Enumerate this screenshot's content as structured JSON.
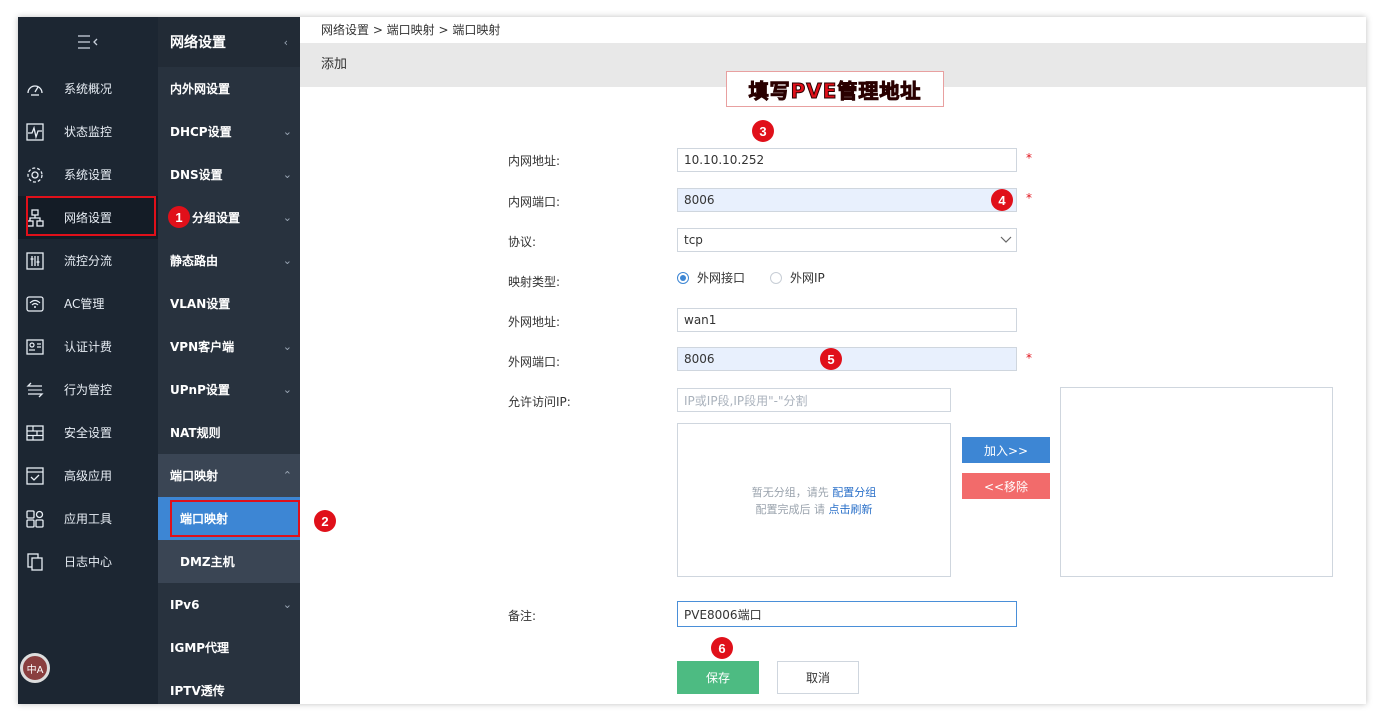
{
  "sidebar": {
    "items": [
      {
        "label": "系统概况",
        "icon": "dashboard-icon"
      },
      {
        "label": "状态监控",
        "icon": "monitor-icon"
      },
      {
        "label": "系统设置",
        "icon": "gear-icon"
      },
      {
        "label": "网络设置",
        "icon": "network-icon"
      },
      {
        "label": "流控分流",
        "icon": "sliders-icon"
      },
      {
        "label": "AC管理",
        "icon": "wifi-icon"
      },
      {
        "label": "认证计费",
        "icon": "id-card-icon"
      },
      {
        "label": "行为管控",
        "icon": "transfer-icon"
      },
      {
        "label": "安全设置",
        "icon": "firewall-icon"
      },
      {
        "label": "高级应用",
        "icon": "inbox-check-icon"
      },
      {
        "label": "应用工具",
        "icon": "apps-icon"
      },
      {
        "label": "日志中心",
        "icon": "log-icon"
      }
    ],
    "lang_badge": "中A"
  },
  "submenu": {
    "title": "网络设置",
    "items": [
      {
        "label": "内外网设置",
        "chevron": false
      },
      {
        "label": "DHCP设置",
        "chevron": true
      },
      {
        "label": "DNS设置",
        "chevron": true
      },
      {
        "label": "分组设置",
        "chevron": true
      },
      {
        "label": "静态路由",
        "chevron": true
      },
      {
        "label": "VLAN设置",
        "chevron": false
      },
      {
        "label": "VPN客户端",
        "chevron": true
      },
      {
        "label": "UPnP设置",
        "chevron": true
      },
      {
        "label": "NAT规则",
        "chevron": false
      },
      {
        "label": "端口映射",
        "chevron": true
      },
      {
        "label": "端口映射",
        "chevron": false
      },
      {
        "label": "DMZ主机",
        "chevron": false
      },
      {
        "label": "IPv6",
        "chevron": true
      },
      {
        "label": "IGMP代理",
        "chevron": false
      },
      {
        "label": "IPTV透传",
        "chevron": false
      }
    ]
  },
  "main": {
    "breadcrumb": "网络设置 > 端口映射 > 端口映射",
    "title": "添加",
    "callout": "填写PVE管理地址",
    "form": {
      "lan_ip_label": "内网地址:",
      "lan_ip_value": "10.10.10.252",
      "lan_port_label": "内网端口:",
      "lan_port_value": "8006",
      "protocol_label": "协议:",
      "protocol_value": "tcp",
      "map_type_label": "映射类型:",
      "map_type_opt1": "外网接口",
      "map_type_opt2": "外网IP",
      "wan_addr_label": "外网地址:",
      "wan_addr_value": "wan1",
      "wan_port_label": "外网端口:",
      "wan_port_value": "8006",
      "allow_ip_label": "允许访问IP:",
      "allow_ip_placeholder": "IP或IP段,IP段用\"-\"分割",
      "empty_line1": "暂无分组，请先",
      "empty_link1": "配置分组",
      "empty_line2": "配置完成后 请",
      "empty_link2": "点击刷新",
      "add_btn": "加入>>",
      "remove_btn": "<<移除",
      "remark_label": "备注:",
      "remark_value": "PVE8006端口",
      "required_mark": "*"
    },
    "save_btn": "保存",
    "cancel_btn": "取消"
  },
  "markers": [
    "1",
    "2",
    "3",
    "4",
    "5",
    "6"
  ],
  "colors": {
    "accent": "#3d86d4",
    "danger": "#e0101a",
    "save": "#4dbb82",
    "remove": "#f26b6b",
    "sidebar": "#1c2632"
  }
}
